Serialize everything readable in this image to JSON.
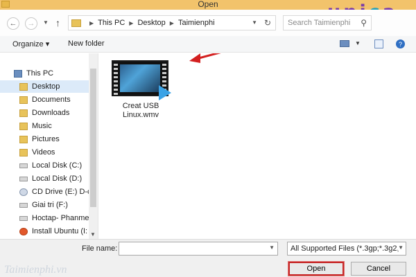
{
  "window": {
    "title": "Open"
  },
  "logo": {
    "letters": [
      "u",
      "n",
      "i",
      "c",
      "a"
    ]
  },
  "address": {
    "crumbs": [
      "This PC",
      "Desktop",
      "Taimienphi"
    ]
  },
  "search": {
    "placeholder": "Search Taimienphi"
  },
  "toolbar": {
    "organize": "Organize ▾",
    "new_folder": "New folder"
  },
  "sidebar": {
    "items": [
      {
        "label": "This PC",
        "icon": "pc-icon"
      },
      {
        "label": "Desktop",
        "icon": "folder-icon"
      },
      {
        "label": "Documents",
        "icon": "folder-icon"
      },
      {
        "label": "Downloads",
        "icon": "folder-icon"
      },
      {
        "label": "Music",
        "icon": "folder-icon"
      },
      {
        "label": "Pictures",
        "icon": "folder-icon"
      },
      {
        "label": "Videos",
        "icon": "folder-icon"
      },
      {
        "label": "Local Disk (C:)",
        "icon": "disk-icon"
      },
      {
        "label": "Local Disk (D:)",
        "icon": "disk-icon"
      },
      {
        "label": "CD Drive (E:) D-c",
        "icon": "cd-icon"
      },
      {
        "label": "Giai tri (F:)",
        "icon": "disk-icon"
      },
      {
        "label": "Hoctap- Phanme",
        "icon": "disk-icon"
      },
      {
        "label": "Install Ubuntu (I:",
        "icon": "ubuntu-icon"
      }
    ],
    "selected": "Desktop"
  },
  "files": [
    {
      "name_line1": "Creat USB",
      "name_line2": "Linux.wmv",
      "icon": "video-file-icon"
    }
  ],
  "bottom": {
    "file_name_label": "File name:",
    "file_name_value": "",
    "filter": "All Supported Files (*.3gp;*.3g2,",
    "open_label": "Open",
    "cancel_label": "Cancel",
    "watermark": "Taimienphi.vn"
  },
  "colors": {
    "title_bar": "#f2c36b",
    "selection": "#dceaf9",
    "highlight_border": "#c62828",
    "logo_purple": "#7b3ea8",
    "logo_teal": "#2aa1b8"
  }
}
